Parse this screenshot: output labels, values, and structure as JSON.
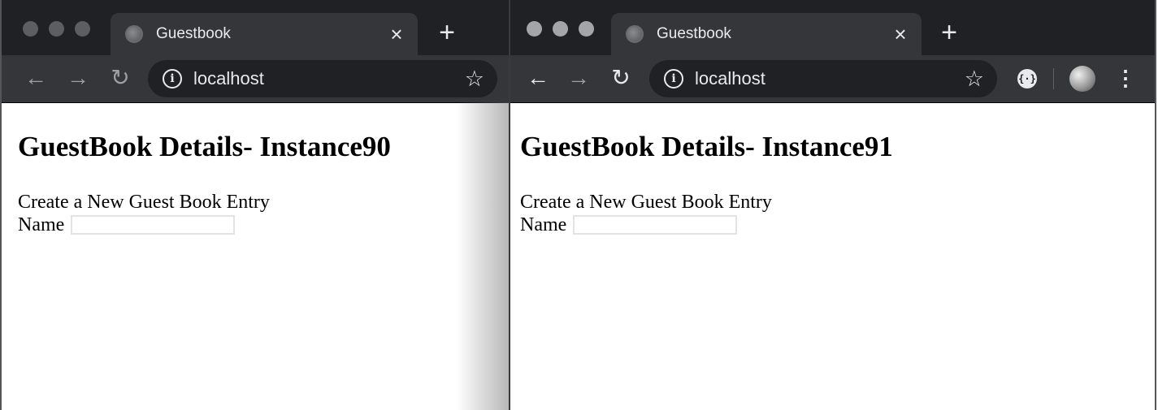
{
  "windows": [
    {
      "tab_title": "Guestbook",
      "tab_close": "×",
      "new_tab": "+",
      "nav": {
        "back": "←",
        "forward": "→",
        "reload": "↻"
      },
      "url": "localhost",
      "info": "i",
      "star": "☆",
      "heading": "GuestBook Details- Instance90",
      "subheading": "Create a New Guest Book Entry",
      "name_label": "Name",
      "name_value": ""
    },
    {
      "tab_title": "Guestbook",
      "tab_close": "×",
      "new_tab": "+",
      "nav": {
        "back": "←",
        "forward": "→",
        "reload": "↻"
      },
      "url": "localhost",
      "info": "i",
      "star": "☆",
      "extension": "{·}",
      "menu": "⋮",
      "heading": "GuestBook Details- Instance91",
      "subheading": "Create a New Guest Book Entry",
      "name_label": "Name",
      "name_value": ""
    }
  ]
}
